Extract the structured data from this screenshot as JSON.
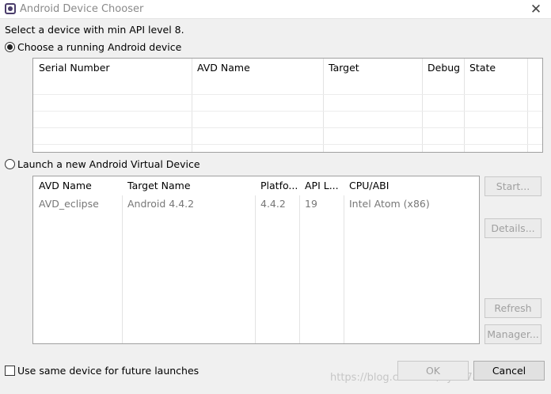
{
  "window": {
    "title": "Android Device Chooser",
    "close_glyph": "✕"
  },
  "prompt": "Select a device with min API level 8.",
  "running": {
    "radio_label": "Choose a running Android device",
    "columns": [
      "Serial Number",
      "AVD Name",
      "Target",
      "Debug",
      "State"
    ],
    "rows": []
  },
  "launch": {
    "radio_label": "Launch a new Android Virtual Device",
    "columns": [
      "AVD Name",
      "Target Name",
      "Platfo...",
      "API L...",
      "CPU/ABI"
    ],
    "rows": [
      [
        "AVD_eclipse",
        "Android 4.4.2",
        "4.4.2",
        "19",
        "Intel Atom (x86)"
      ]
    ],
    "buttons": {
      "start": "Start...",
      "details": "Details...",
      "refresh": "Refresh",
      "manager": "Manager..."
    }
  },
  "footer": {
    "same_device_label": "Use same device for future launches",
    "ok_label": "OK",
    "cancel_label": "Cancel"
  },
  "watermark": "https://blog.csdn.net/hyh17808770899"
}
